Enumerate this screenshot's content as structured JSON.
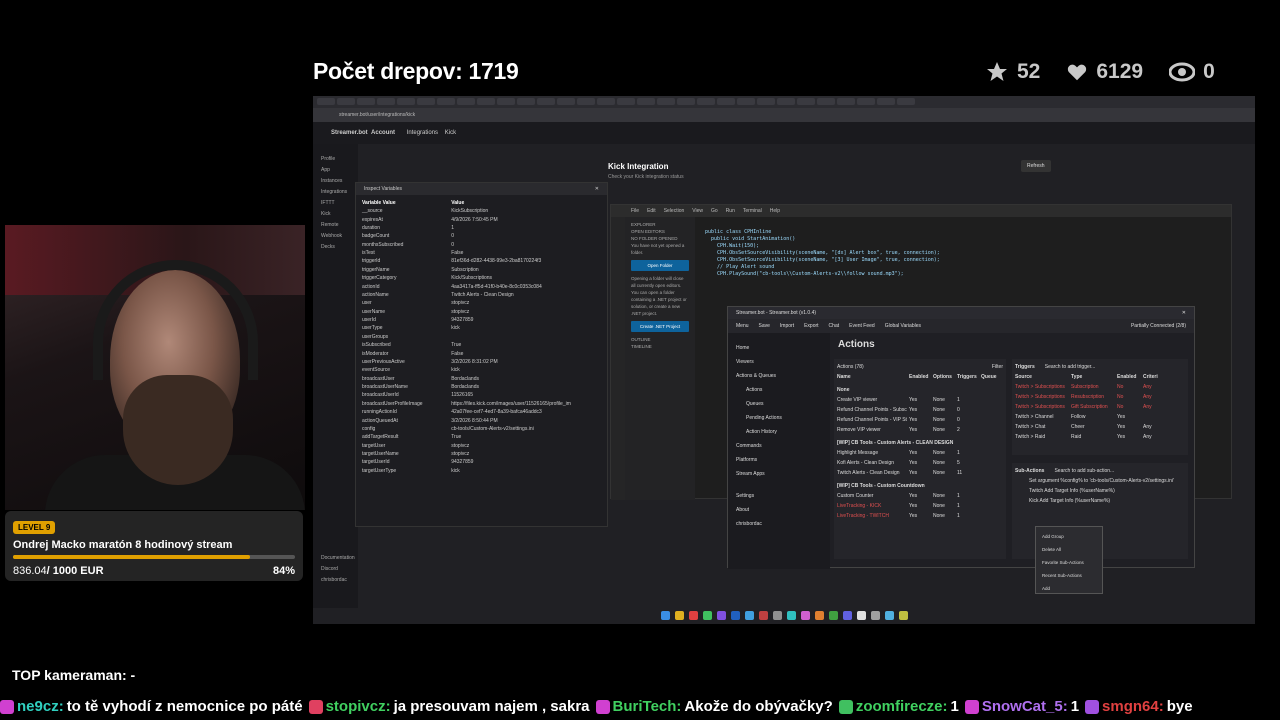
{
  "overlay": {
    "title": "Počet drepov: 1719",
    "stats": [
      {
        "icon": "star-icon",
        "value": "52"
      },
      {
        "icon": "heart-icon",
        "value": "6129"
      },
      {
        "icon": "eye-icon",
        "value": "0"
      }
    ],
    "goal": {
      "level": "LEVEL 9",
      "title": "Ondrej Macko maratón 8 hodinový stream",
      "current": "836.04",
      "target": "/ 1000 EUR",
      "percent_label": "84%",
      "progress": 0.84,
      "accent": "#e0a000"
    },
    "top_cameraman": "TOP kameraman: -",
    "chat": [
      {
        "name": "ne9cz:",
        "color": "#30d0c0",
        "msg": "to tě vyhodí z nemocnice po páté"
      },
      {
        "name": "stopivcz:",
        "color": "#40d060",
        "msg": "ja presouvam najem , sakra"
      },
      {
        "name": "BuriTech:",
        "color": "#40d060",
        "msg": "Akože do obývačky?"
      },
      {
        "name": "zoomfirecze:",
        "color": "#40d060",
        "msg": "1"
      },
      {
        "name": "SnowCat_5:",
        "color": "#b070f0",
        "msg": "1"
      },
      {
        "name": "smgn64:",
        "color": "#e04040",
        "msg": "bye"
      }
    ]
  },
  "screen": {
    "address": "streamer.bot/user/integrations/kick",
    "header": {
      "brand": "Streamer.bot",
      "account": "Account",
      "crumb1": "Integrations",
      "crumb2": "Kick"
    },
    "sidebar": [
      "Profile",
      "App Instances",
      "Integrations",
      "IFTTT",
      "Kick",
      "Remote",
      "Webhook",
      "Decks",
      "Documentation",
      "Discord",
      "chrisbordac"
    ],
    "kick": {
      "title": "Kick Integration",
      "subtitle": "Check your Kick integration status",
      "refresh": "Refresh"
    },
    "inspect": {
      "title": "Inspect Variables",
      "col_var": "Variable Value",
      "col_val": "Value",
      "rows": [
        [
          "__source",
          "KickSubscription"
        ],
        [
          "expiresAt",
          "4/9/2026 7:50:45 PM"
        ],
        [
          "duration",
          "1"
        ],
        [
          "badgeCount",
          "0"
        ],
        [
          "monthsSubscribed",
          "0"
        ],
        [
          "isTest",
          "False"
        ],
        [
          "triggerId",
          "81ef36d-d282-4438-99e3-2ba8170224f3"
        ],
        [
          "triggerName",
          "Subscription"
        ],
        [
          "triggerCategory",
          "Kick/Subscriptions"
        ],
        [
          "actionId",
          "4aa3417a-ff5d-41f0-b40e-8c0c0353c084"
        ],
        [
          "actionName",
          "Twitch Alerts - Clean Design"
        ],
        [
          "user",
          "stopivcz"
        ],
        [
          "userName",
          "stopivcz"
        ],
        [
          "userId",
          "94327859"
        ],
        [
          "userType",
          "kick"
        ],
        [
          "userGroups",
          ""
        ],
        [
          "isSubscribed",
          "True"
        ],
        [
          "isModerator",
          "False"
        ],
        [
          "userPreviousActive",
          "3/2/2026 8:31:02 PM"
        ],
        [
          "eventSource",
          "kick"
        ],
        [
          "broadcastUser",
          "Bordaclands"
        ],
        [
          "broadcastUserName",
          "Bordaclands"
        ],
        [
          "broadcastUserId",
          "11526165"
        ],
        [
          "broadcastUserProfileImage",
          "https://files.kick.com/images/user/11526165/profile_im"
        ],
        [
          "runningActionId",
          "42a07fee-cef7-4ed7-8a39-bafca46addc3"
        ],
        [
          "actionQueuedAt",
          "3/2/2026 8:50:44 PM"
        ],
        [
          "config",
          "cb-tools/Custom-Alerts-v2/settings.ini"
        ],
        [
          "addTargetResult",
          "True"
        ],
        [
          "targetUser",
          "stopivcz"
        ],
        [
          "targetUserName",
          "stopivcz"
        ],
        [
          "targetUserId",
          "94327859"
        ],
        [
          "targetUserType",
          "kick"
        ]
      ]
    },
    "vscode": {
      "menu": [
        "File",
        "Edit",
        "Selection",
        "View",
        "Go",
        "Run",
        "Terminal",
        "Help"
      ],
      "explorer": [
        "EXPLORER",
        "OPEN EDITORS",
        "NO FOLDER OPENED",
        "You have not yet opened a folder.",
        "Open Folder",
        "Opening a folder will close all currently open editors.",
        "You can open a folder containing a .NET project or solution, or create a new .NET project.",
        "Create .NET Project",
        "OUTLINE",
        "TIMELINE"
      ],
      "code": [
        "public class CPHInline",
        "  public void StartAnimation()",
        "    CPH.Wait(150);",
        "",
        "    CPH.ObsSetSourceVisibility(sceneName, \"[dx] Alert box\", true, connection);",
        "    CPH.ObsSetSourceVisibility(sceneName, \"[3] User Image\", true, connection);",
        "    // Play Alert sound",
        "    CPH.PlaySound(\"cb-tools\\\\Custom-Alerts-v2\\\\follow sound.mp3\");"
      ]
    },
    "streamerbot": {
      "window_title": "Streamer.bot - Streamer.bot (v1.0.4)",
      "toolbar": [
        "Menu",
        "Save",
        "Import",
        "Export",
        "Chat",
        "Event Feed",
        "Global Variables"
      ],
      "status": "Partially Connected (2/8)",
      "nav": [
        "Home",
        "Viewers",
        "Actions & Queues",
        "Actions",
        "Queues",
        "Pending Actions",
        "Action History",
        "Commands",
        "Platforms",
        "Stream Apps",
        "Settings",
        "About",
        "chrisbordac"
      ],
      "actions_title": "Actions",
      "actions_header": "Actions (78)",
      "filter": "Filter",
      "cols": [
        "Name",
        "Enabled",
        "Options",
        "Triggers",
        "Queue"
      ],
      "groups": [
        {
          "name": "None",
          "rows": [
            [
              "Create VIP viewer",
              "Yes",
              "None",
              "1"
            ],
            [
              "Refund Channel Points - Subsc",
              "Yes",
              "None",
              "0"
            ],
            [
              "Refund Channel Points - VIP St",
              "Yes",
              "None",
              "0"
            ],
            [
              "Remove VIP viewer",
              "Yes",
              "None",
              "2"
            ]
          ]
        },
        {
          "name": "[WIP] CB Tools - Custom Alerts - CLEAN DESIGN",
          "rows": [
            [
              "Highlight Message",
              "Yes",
              "None",
              "1"
            ],
            [
              "Kofi Alerts - Clean Design",
              "Yes",
              "None",
              "5"
            ],
            [
              "Twitch Alerts - Clean Design",
              "Yes",
              "None",
              "11"
            ]
          ]
        },
        {
          "name": "[WIP] CB Tools - Custom Countdown",
          "rows": [
            [
              "Custom Counter",
              "Yes",
              "None",
              "1"
            ],
            [
              "LiveTracking - KICK",
              "Yes",
              "None",
              "1"
            ],
            [
              "LiveTracking - TWITCH",
              "Yes",
              "None",
              "1"
            ]
          ]
        }
      ],
      "triggers_title": "Triggers",
      "triggers_search": "Search to add trigger...",
      "trigger_cols": [
        "Source",
        "Type",
        "Enabled",
        "Criteri"
      ],
      "triggers": [
        [
          "Twitch > Subscriptions",
          "Subscription",
          "No",
          "Any"
        ],
        [
          "Twitch > Subscriptions",
          "Resubscription",
          "No",
          "Any"
        ],
        [
          "Twitch > Subscriptions",
          "Gift Subscription",
          "No",
          "Any"
        ],
        [
          "Twitch > Channel",
          "Follow",
          "Yes",
          ""
        ],
        [
          "Twitch > Chat",
          "Cheer",
          "Yes",
          "Any"
        ],
        [
          "Twitch > Raid",
          "Raid",
          "Yes",
          "Any"
        ]
      ],
      "subactions_title": "Sub-Actions",
      "subactions_search": "Search to add sub-action...",
      "subactions": [
        "Set argument %config% to 'cb-tools/Custom-Alerts-v2/settings.ini'",
        "Twitch Add Target Info (%userName%)",
        "Kick Add Target Info (%userName%)"
      ],
      "context_menu": [
        "Add Group",
        "Delete All",
        "Favorite Sub-Actions",
        "Recent Sub-Actions",
        "Add"
      ]
    }
  }
}
